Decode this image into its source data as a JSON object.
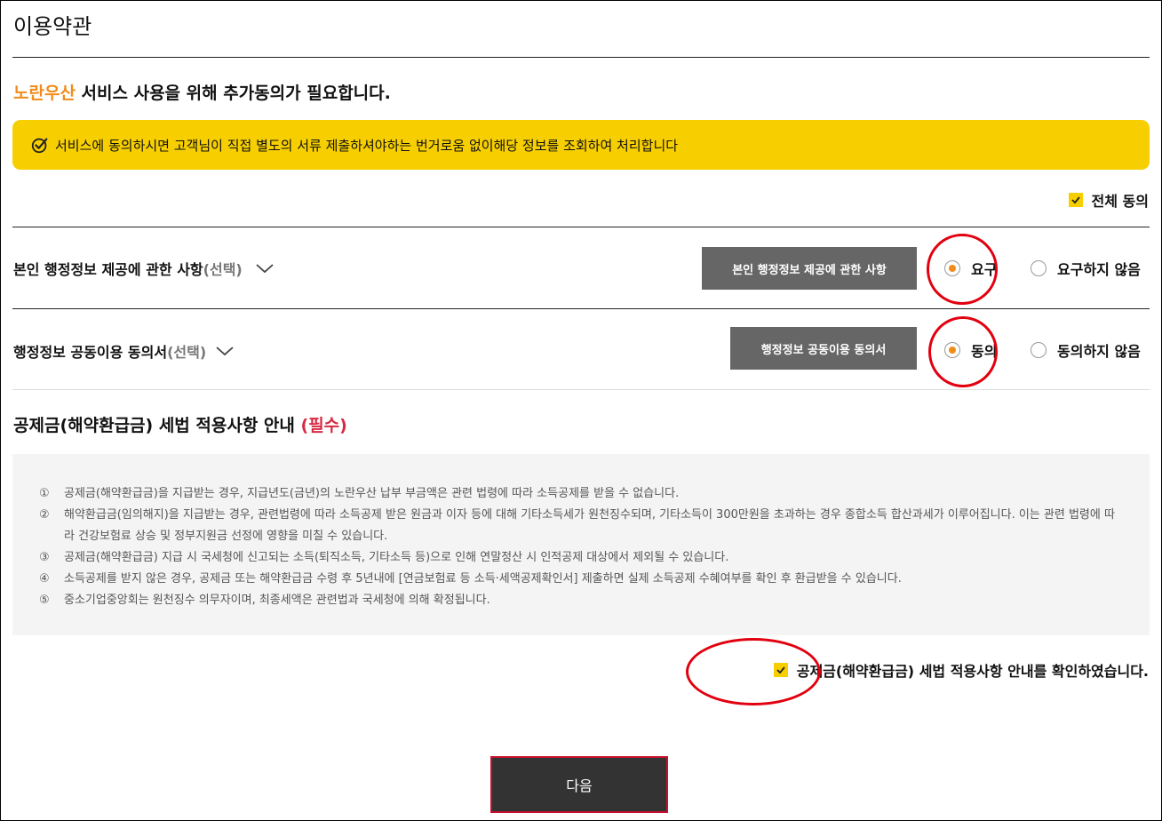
{
  "page": {
    "title": "이용약관"
  },
  "headline": {
    "brand": "노란우산",
    "text": " 서비스 사용을 위해 추가동의가 필요합니다."
  },
  "notice": {
    "text": "서비스에 동의하시면 고객님이 직접 별도의 서류 제출하셔야하는 번거로움 없이해당 정보를 조회하여 처리합니다"
  },
  "agree_all": {
    "label": "전체 동의",
    "checked": true
  },
  "rows": [
    {
      "title": "본인 행정정보 제공에 관한 사항",
      "optional": "(선택)",
      "button": "본인 행정정보 제공에 관한 사항",
      "yes_label": "요구",
      "no_label": "요구하지 않음",
      "selected": "yes"
    },
    {
      "title": "행정정보 공동이용 동의서",
      "optional": "(선택)",
      "button": "행정정보 공동이용 동의서",
      "yes_label": "동의",
      "no_label": "동의하지 않음",
      "selected": "yes"
    }
  ],
  "section": {
    "title": "공제금(해약환급금) 세법 적용사항 안내 ",
    "required": "(필수)"
  },
  "terms": [
    {
      "num": "①",
      "text": "공제금(해약환급금)을 지급받는 경우, 지급년도(금년)의 노란우산 납부 부금액은 관련 법령에 따라 소득공제를 받을 수 없습니다."
    },
    {
      "num": "②",
      "text": "해약환급금(임의해지)을 지급받는 경우, 관련법령에 따라 소득공제 받은 원금과 이자 등에 대해 기타소득세가 원천징수되며, 기타소득이 300만원을 초과하는 경우 종합소득 합산과세가 이루어집니다. 이는 관련 법령에 따라 건강보험료 상승 및 정부지원금 선정에 영향을 미칠 수 있습니다."
    },
    {
      "num": "③",
      "text": "공제금(해약환급금) 지급 시 국세청에 신고되는 소득(퇴직소득, 기타소득 등)으로 인해 연말정산 시 인적공제 대상에서 제외될 수 있습니다."
    },
    {
      "num": "④",
      "text": "소득공제를 받지 않은 경우, 공제금 또는 해약환급금 수령 후 5년내에 [연금보험료 등 소득·세액공제확인서] 제출하면 실제 소득공제 수혜여부를 확인 후 환급받을 수 있습니다."
    },
    {
      "num": "⑤",
      "text": "중소기업중앙회는 원천징수 의무자이며, 최종세액은 관련법과 국세청에 의해 확정됩니다."
    }
  ],
  "confirm": {
    "label": "공제금(해약환급금) 세법 적용사항 안내를 확인하였습니다.",
    "checked": true
  },
  "next_button": {
    "label": "다음"
  },
  "colors": {
    "brand": "#f08c1a",
    "accent_yellow": "#f7cf00",
    "required_red": "#d62b44",
    "annotation_red": "#e2000f"
  }
}
